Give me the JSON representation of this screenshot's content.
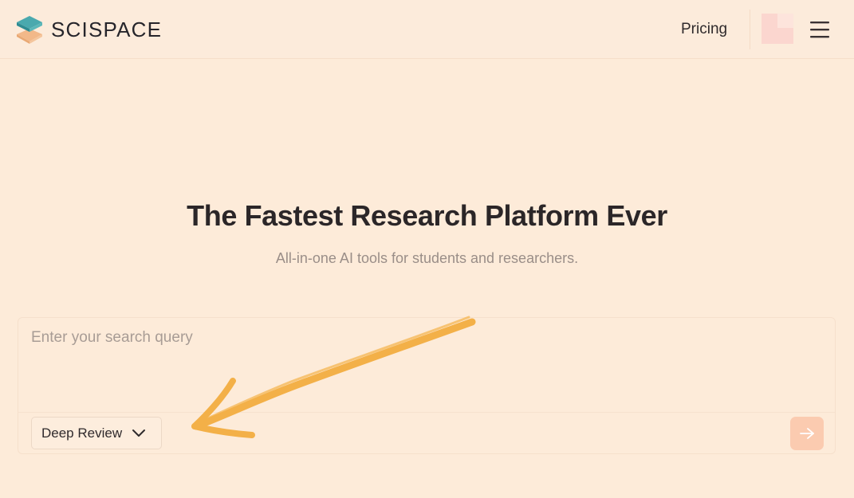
{
  "header": {
    "brand": "SCISPACE",
    "pricing_label": "Pricing"
  },
  "hero": {
    "title": "The Fastest Research Platform Ever",
    "subtitle": "All-in-one AI tools for students and researchers."
  },
  "search": {
    "placeholder": "Enter your search query",
    "value": "",
    "mode": {
      "selected": "Deep Review"
    }
  },
  "icons": {
    "logo": "stacked-layers-logo",
    "avatar": "user-avatar",
    "menu": "hamburger-menu-icon",
    "mode_dropdown": "chevron-down-icon",
    "submit": "arrow-right-icon",
    "annotation": "hand-drawn-arrow"
  },
  "colors": {
    "background": "#fdebd9",
    "logo_teal": "#3f9fa6",
    "logo_orange": "#f2b889",
    "avatar": "#fbd6cf",
    "submit_button": "#fbcbb0",
    "annotation": "#f3ac3c"
  }
}
